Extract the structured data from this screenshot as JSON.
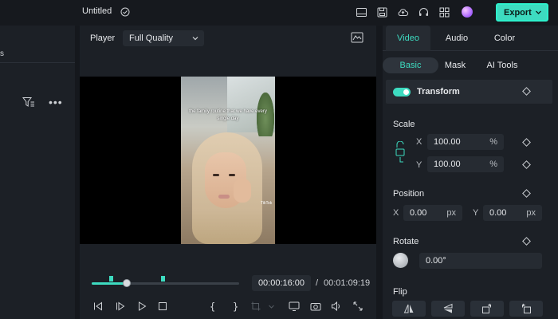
{
  "app": {
    "title": "Untitled",
    "export_label": "Export"
  },
  "left_panel": {
    "label": "s"
  },
  "player": {
    "label": "Player",
    "quality": "Full Quality",
    "caption": "the family routine that we have every single day",
    "watermark": "TikTok",
    "current_time": "00:00:16:00",
    "separator": "/",
    "total_time": "00:01:09:19",
    "progress": 0.24
  },
  "properties": {
    "tabs": [
      {
        "label": "Video",
        "active": true
      },
      {
        "label": "Audio",
        "active": false
      },
      {
        "label": "Color",
        "active": false
      }
    ],
    "subtabs": [
      {
        "label": "Basic",
        "active": true
      },
      {
        "label": "Mask",
        "active": false
      },
      {
        "label": "AI Tools",
        "active": false
      }
    ],
    "transform": {
      "title": "Transform",
      "enabled": true
    },
    "scale": {
      "label": "Scale",
      "x_axis": "X",
      "x_value": "100.00",
      "y_axis": "Y",
      "y_value": "100.00",
      "unit": "%"
    },
    "position": {
      "label": "Position",
      "x_axis": "X",
      "x_value": "0.00",
      "y_axis": "Y",
      "y_value": "0.00",
      "unit": "px"
    },
    "rotate": {
      "label": "Rotate",
      "value": "0.00°"
    },
    "flip": {
      "label": "Flip"
    }
  },
  "colors": {
    "accent": "#3ddbc0",
    "panel": "#1c2026",
    "field": "#262b32"
  }
}
